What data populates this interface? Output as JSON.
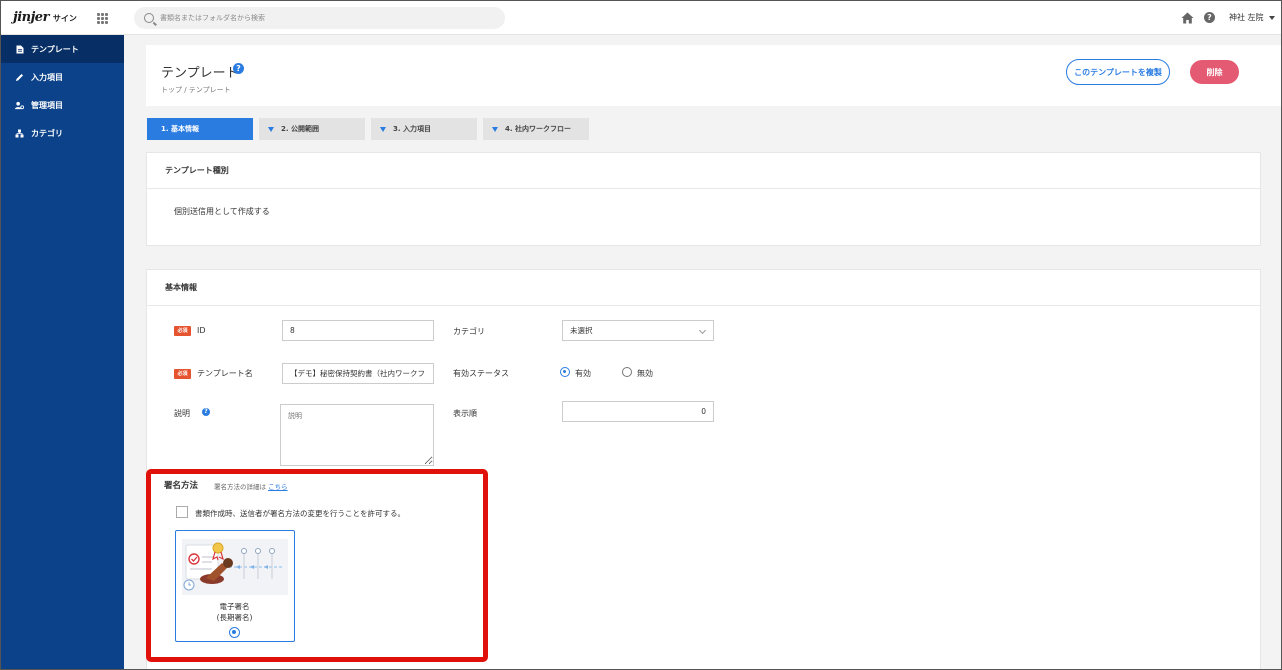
{
  "header": {
    "logo_text": "jinjer",
    "logo_sub": "サイン",
    "search_placeholder": "書類名またはフォルダ名から検索",
    "user_name": "神社 左院"
  },
  "sidebar": {
    "items": [
      {
        "label": "テンプレート",
        "icon": "document-icon",
        "active": true
      },
      {
        "label": "入力項目",
        "icon": "pencil-icon",
        "active": false
      },
      {
        "label": "管理項目",
        "icon": "user-gear-icon",
        "active": false
      },
      {
        "label": "カテゴリ",
        "icon": "category-tree-icon",
        "active": false
      }
    ]
  },
  "page": {
    "title": "テンプレート",
    "breadcrumb": "トップ / テンプレート",
    "copy_button": "このテンプレートを複製",
    "delete_button": "削除"
  },
  "steps": [
    {
      "label": "1. 基本情報",
      "active": true
    },
    {
      "label": "2. 公開範囲",
      "active": false
    },
    {
      "label": "3. 入力項目",
      "active": false
    },
    {
      "label": "4. 社内ワークフロー",
      "active": false
    }
  ],
  "template_type": {
    "heading": "テンプレート種別",
    "value": "個別送信用として作成する"
  },
  "basic_info": {
    "heading": "基本情報",
    "required_badge": "必須",
    "id_label": "ID",
    "id_value": "8",
    "category_label": "カテゴリ",
    "category_value": "未選択",
    "name_label": "テンプレート名",
    "name_value": "【デモ】秘密保持契約書（社内ワークフ",
    "status_label": "有効ステータス",
    "status_options": [
      "有効",
      "無効"
    ],
    "status_selected": "有効",
    "description_label": "説明",
    "description_placeholder": "説明",
    "order_label": "表示順",
    "order_value": "0"
  },
  "signature": {
    "heading": "署名方法",
    "note_prefix": "署名方法の詳細は",
    "note_link": "こちら",
    "allow_change_label": "書類作成時、送信者が署名方法の変更を行うことを許可する。",
    "allow_change_checked": false,
    "method_line1": "電子署名",
    "method_line2": "(長期署名)",
    "method_selected": true
  },
  "colors": {
    "sidebar": "#0b4289",
    "accent": "#2a7ce1",
    "delete": "#e45a72",
    "highlight": "#e0100b",
    "required": "#e5532f"
  }
}
